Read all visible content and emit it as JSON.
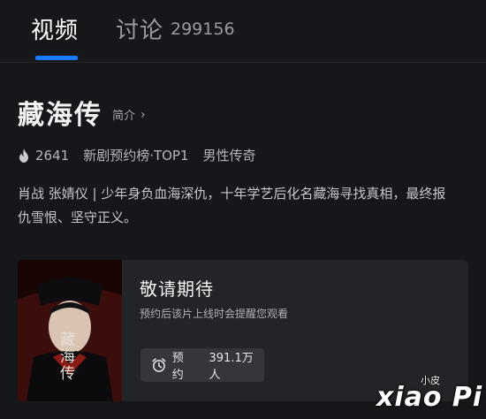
{
  "tabs": {
    "video_label": "视频",
    "discuss_label": "讨论",
    "discuss_count": "299156"
  },
  "show": {
    "title": "藏海传",
    "intro_link": "简介",
    "heat": "2641",
    "rank": "新剧预约榜·TOP1",
    "genre": "男性传奇",
    "description": "肖战 张婧仪 | 少年身负血海深仇，十年学艺后化名藏海寻找真相，最终报仇雪恨、坚守正义。"
  },
  "card": {
    "title": "敬请期待",
    "subtitle": "预约后该片上线时会提醒您观看",
    "reserve_label": "预约",
    "reserve_count": "391.1万人",
    "poster_text": "藏海传"
  },
  "watermark": {
    "text_top": "小皮",
    "text_main": "xiao Pi"
  },
  "colors": {
    "background": "#16171b",
    "accent": "#1a7dff",
    "card": "#232428"
  },
  "icons": [
    "flame-icon",
    "chevron-right-icon",
    "alarm-clock-icon"
  ]
}
